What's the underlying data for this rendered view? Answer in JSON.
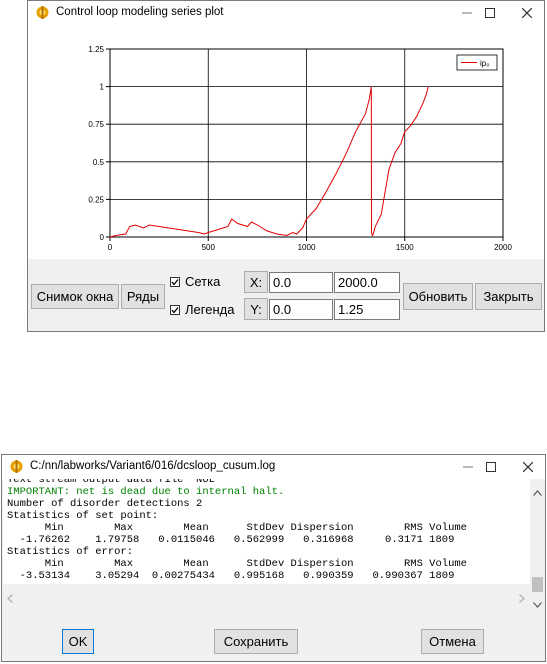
{
  "plot_window": {
    "title": "Control loop modeling series plot",
    "chart_data": {
      "type": "line",
      "title": "",
      "xlabel": "",
      "ylabel": "",
      "xlim": [
        0,
        2000
      ],
      "ylim": [
        0,
        1.25
      ],
      "x_ticks": [
        "0",
        "500",
        "1000",
        "1500",
        "2000"
      ],
      "y_ticks": [
        "0",
        "0.25",
        "0.5",
        "0.75",
        "1",
        "1.25"
      ],
      "grid": true,
      "legend_position": "top-right",
      "series_color": "#e00000",
      "series": [
        {
          "name": "ip₀",
          "x": [
            0,
            30,
            80,
            100,
            130,
            170,
            200,
            250,
            300,
            350,
            400,
            450,
            480,
            500,
            550,
            600,
            620,
            650,
            700,
            720,
            750,
            800,
            850,
            900,
            930,
            950,
            980,
            1000,
            1050,
            1100,
            1150,
            1200,
            1250,
            1300,
            1320,
            1330,
            1331,
            1335,
            1340,
            1350,
            1380,
            1400,
            1420,
            1450,
            1480,
            1500,
            1530,
            1560,
            1590,
            1610,
            1620
          ],
          "y": [
            0,
            0.01,
            0.02,
            0.07,
            0.08,
            0.06,
            0.08,
            0.07,
            0.06,
            0.05,
            0.04,
            0.03,
            0.02,
            0.03,
            0.05,
            0.07,
            0.12,
            0.09,
            0.07,
            0.1,
            0.08,
            0.04,
            0.02,
            0.01,
            0.03,
            0.02,
            0.06,
            0.12,
            0.19,
            0.3,
            0.42,
            0.55,
            0.7,
            0.82,
            0.92,
            1.0,
            0.03,
            0.01,
            0.02,
            0.07,
            0.15,
            0.3,
            0.45,
            0.56,
            0.62,
            0.7,
            0.74,
            0.8,
            0.88,
            0.95,
            1.0
          ]
        }
      ]
    },
    "buttons": {
      "snapshot": "Снимок окна",
      "series": "Ряды",
      "refresh": "Обновить",
      "close": "Закрыть",
      "x_btn": "X:",
      "y_btn": "Y:"
    },
    "checkboxes": {
      "grid_label": "Сетка",
      "grid_checked": true,
      "legend_label": "Легенда",
      "legend_checked": true
    },
    "fields": {
      "x_min": "0.0",
      "x_max": "2000.0",
      "y_min": "0.0",
      "y_max": "1.25"
    }
  },
  "log_window": {
    "title": "C:/nn/labworks/Variant6/016/dcsloop_cusum.log",
    "lines": [
      {
        "text": "Text stream output data file 'NUL'",
        "color": "#000000"
      },
      {
        "text": "IMPORTANT: net is dead due to internal halt.",
        "color": "#008000"
      },
      {
        "text": "Number of disorder detections 2",
        "color": "#000000"
      },
      {
        "text": "Statistics of set point:",
        "color": "#000000"
      },
      {
        "text": "      Min        Max        Mean      StdDev Dispersion        RMS Volume",
        "color": "#000000"
      },
      {
        "text": "  -1.76262    1.79758   0.0115046   0.562999   0.316968     0.3171 1809",
        "color": "#000000"
      },
      {
        "text": "Statistics of error:",
        "color": "#000000"
      },
      {
        "text": "      Min        Max        Mean      StdDev Dispersion        RMS Volume",
        "color": "#000000"
      },
      {
        "text": "  -3.53134    3.05294  0.00275434   0.995168   0.990359   0.990367 1809",
        "color": "#000000"
      }
    ],
    "buttons": {
      "ok": "OK",
      "save": "Сохранить",
      "cancel": "Отмена"
    }
  }
}
